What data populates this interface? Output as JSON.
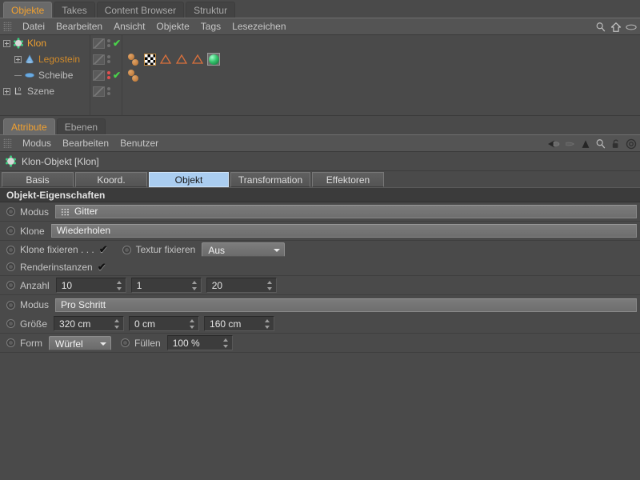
{
  "object_manager": {
    "tabs": [
      {
        "label": "Objekte",
        "active": true
      },
      {
        "label": "Takes",
        "active": false
      },
      {
        "label": "Content Browser",
        "active": false
      },
      {
        "label": "Struktur",
        "active": false
      }
    ],
    "menu": [
      "Datei",
      "Bearbeiten",
      "Ansicht",
      "Objekte",
      "Tags",
      "Lesezeichen"
    ],
    "menu_icons": [
      "search-icon",
      "home-icon",
      "eye-icon"
    ],
    "rows": [
      {
        "name": "Klon",
        "icon": "cloner-object-icon",
        "depth": 0,
        "expander": "plus",
        "selected": true,
        "visibility_dots": [
          "gray",
          "gray"
        ],
        "check": true,
        "tags": []
      },
      {
        "name": "Legostein",
        "icon": "cone-object-icon",
        "depth": 1,
        "expander": "plus",
        "selected": false,
        "visibility_dots": [
          "gray",
          "gray"
        ],
        "check": false,
        "tags": [
          "sphere-pair-tag",
          "checker-texture-tag",
          "triangle-tag",
          "triangle-tag",
          "triangle-tag",
          "material-tag"
        ]
      },
      {
        "name": "Scheibe",
        "icon": "disc-object-icon",
        "depth": 1,
        "expander": "line",
        "selected": false,
        "visibility_dots": [
          "red",
          "red"
        ],
        "check": true,
        "tags": [
          "sphere-pair-tag"
        ]
      },
      {
        "name": "Szene",
        "icon": "layer-zero-icon",
        "depth": 0,
        "expander": "plus",
        "selected": false,
        "visibility_dots": [
          "gray",
          "gray"
        ],
        "check": false,
        "tags": []
      }
    ]
  },
  "attribute_manager": {
    "tabs": [
      {
        "label": "Attribute",
        "active": true
      },
      {
        "label": "Ebenen",
        "active": false
      }
    ],
    "menu": [
      "Modus",
      "Bearbeiten",
      "Benutzer"
    ],
    "menu_icons": [
      "back-arrow-icon",
      "forward-arrow-icon",
      "up-arrow-icon",
      "search-icon",
      "lock-icon",
      "target-icon"
    ],
    "object_title": "Klon-Objekt [Klon]",
    "object_title_icon": "cloner-object-icon",
    "param_tabs": [
      {
        "label": "Basis",
        "active": false
      },
      {
        "label": "Koord.",
        "active": false
      },
      {
        "label": "Objekt",
        "active": true
      },
      {
        "label": "Transformation",
        "active": false
      },
      {
        "label": "Effektoren",
        "active": false
      }
    ],
    "section_title": "Objekt-Eigenschaften",
    "fields": {
      "modus_label": "Modus",
      "modus_value": "Gitter",
      "modus_icon": "grid-array-icon",
      "klone_label": "Klone",
      "klone_value": "Wiederholen",
      "klone_fixieren_label": "Klone fixieren . . .",
      "klone_fixieren_checked": true,
      "textur_fixieren_label": "Textur fixieren",
      "textur_fixieren_value": "Aus",
      "renderinstanzen_label": "Renderinstanzen",
      "renderinstanzen_checked": true,
      "anzahl_label": "Anzahl",
      "anzahl_x": "10",
      "anzahl_y": "1",
      "anzahl_z": "20",
      "modus2_label": "Modus",
      "modus2_value": "Pro Schritt",
      "groesse_label": "Größe",
      "groesse_x": "320 cm",
      "groesse_y": "0 cm",
      "groesse_z": "160 cm",
      "form_label": "Form",
      "form_value": "Würfel",
      "fuellen_label": "Füllen",
      "fuellen_value": "100 %"
    }
  },
  "colors": {
    "panel_bg": "#4a4a4a",
    "menu_bg": "#545454",
    "tab_active_text": "#f0a030",
    "param_tab_active_bg": "#aacdf0",
    "section_header_bg": "#3b3b3b",
    "field_bg": "#3c3c3c",
    "combo_bg": "#767676"
  }
}
